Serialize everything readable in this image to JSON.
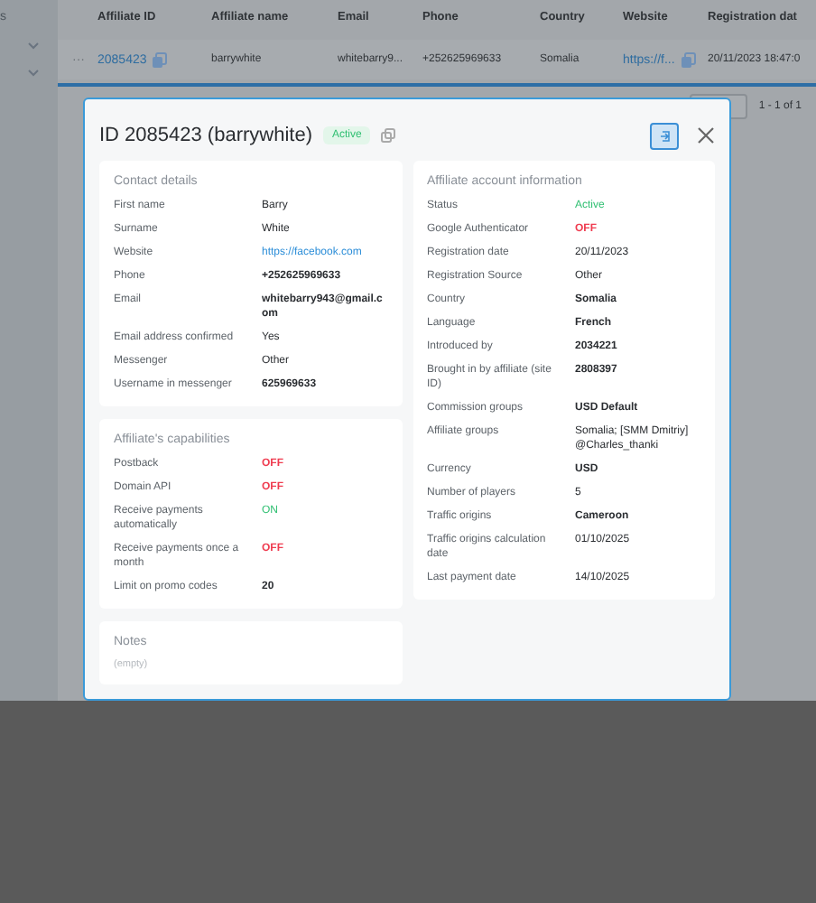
{
  "sidebar": {
    "items": [
      {
        "label": "s"
      }
    ]
  },
  "table": {
    "columns": [
      "Affiliate ID",
      "Affiliate name",
      "Email",
      "Phone",
      "Country",
      "Website",
      "Registration dat"
    ],
    "rows": [
      {
        "menu": "···",
        "cells": [
          {
            "text": "2085423",
            "kind": "link",
            "copy": true
          },
          {
            "text": "barrywhite",
            "kind": "plain",
            "copy": false
          },
          {
            "text": "whitebarry9...",
            "kind": "plain",
            "copy": false
          },
          {
            "text": "+252625969633",
            "kind": "plain",
            "copy": false
          },
          {
            "text": "Somalia",
            "kind": "plain",
            "copy": false
          },
          {
            "text": "https://f...",
            "kind": "link",
            "copy": true
          },
          {
            "text": "20/11/2023 18:47:0",
            "kind": "plain",
            "copy": false
          }
        ]
      }
    ]
  },
  "pagination": {
    "range": "1 - 1 of 1"
  },
  "modal": {
    "title": "ID 2085423 (barrywhite)",
    "badge": "Active",
    "left": [
      {
        "title": "Contact details",
        "rows": [
          {
            "label": "First name",
            "value": "Barry",
            "kind": "plain"
          },
          {
            "label": "Surname",
            "value": "White",
            "kind": "plain"
          },
          {
            "label": "Website",
            "value": "https://facebook.com",
            "kind": "link"
          },
          {
            "label": "Phone",
            "value": "+252625969633",
            "kind": "strong"
          },
          {
            "label": "Email",
            "value": "whitebarry943@gmail.com",
            "kind": "strong"
          },
          {
            "label": "Email address confirmed",
            "value": "Yes",
            "kind": "plain"
          },
          {
            "label": "Messenger",
            "value": "Other",
            "kind": "plain"
          },
          {
            "label": "Username in messenger",
            "value": "625969633",
            "kind": "strong"
          }
        ]
      },
      {
        "title": "Affiliate's capabilities",
        "rows": [
          {
            "label": "Postback",
            "value": "OFF",
            "kind": "off"
          },
          {
            "label": "Domain API",
            "value": "OFF",
            "kind": "off"
          },
          {
            "label": "Receive payments automatically",
            "value": "ON",
            "kind": "on"
          },
          {
            "label": "Receive payments once a month",
            "value": "OFF",
            "kind": "off"
          },
          {
            "label": "Limit on promo codes",
            "value": "20",
            "kind": "strong"
          }
        ]
      },
      {
        "title": "Notes",
        "text": "(empty)"
      }
    ],
    "right": [
      {
        "title": "Affiliate account information",
        "rows": [
          {
            "label": "Status",
            "value": "Active",
            "kind": "on"
          },
          {
            "label": "Google Authenticator",
            "value": "OFF",
            "kind": "off"
          },
          {
            "label": "Registration date",
            "value": "20/11/2023",
            "kind": "plain"
          },
          {
            "label": "Registration Source",
            "value": "Other",
            "kind": "plain"
          },
          {
            "label": "Country",
            "value": "Somalia",
            "kind": "strong"
          },
          {
            "label": "Language",
            "value": "French",
            "kind": "strong"
          },
          {
            "label": "Introduced by",
            "value": "2034221",
            "kind": "strong"
          },
          {
            "label": "Brought in by affiliate (site ID)",
            "value": "2808397",
            "kind": "strong"
          },
          {
            "label": "Commission groups",
            "value": "USD Default",
            "kind": "strong"
          },
          {
            "label": "Affiliate groups",
            "value": "Somalia; [SMM Dmitriy] @Charles_thanki",
            "kind": "plain"
          },
          {
            "label": "Currency",
            "value": "USD",
            "kind": "strong"
          },
          {
            "label": "Number of players",
            "value": "5",
            "kind": "plain"
          },
          {
            "label": "Traffic origins",
            "value": "Cameroon",
            "kind": "strong"
          },
          {
            "label": "Traffic origins calculation date",
            "value": "01/10/2025",
            "kind": "plain"
          },
          {
            "label": "Last payment date",
            "value": "14/10/2025",
            "kind": "plain"
          }
        ]
      }
    ]
  }
}
